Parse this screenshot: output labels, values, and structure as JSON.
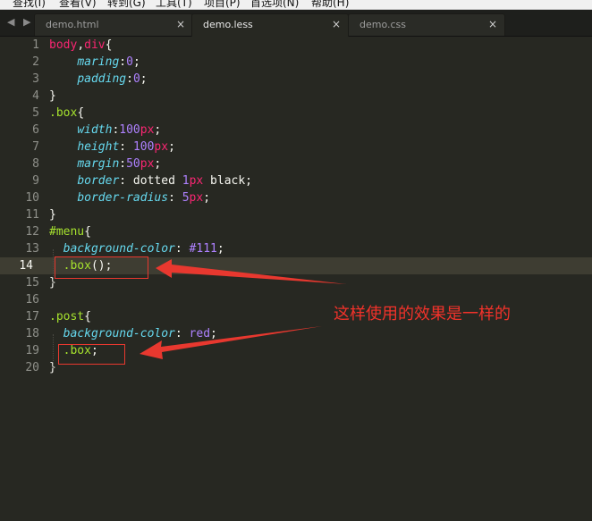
{
  "menu": [
    "查找(I)",
    "查看(V)",
    "转到(G)",
    "工具(T)",
    "项目(P)",
    "首选项(N)",
    "帮助(H)"
  ],
  "nav_arrows": "◀ ▶",
  "tabs": [
    {
      "label": "demo.html",
      "close": "×",
      "active": false
    },
    {
      "label": "demo.less",
      "close": "×",
      "active": true
    },
    {
      "label": "demo.css",
      "close": "×",
      "active": false
    }
  ],
  "current_line": 14,
  "code": [
    {
      "n": "1",
      "tokens": [
        [
          "tag",
          "body"
        ],
        [
          "",
          ","
        ],
        [
          "tag",
          "div"
        ],
        [
          "",
          "{"
        ]
      ]
    },
    {
      "n": "2",
      "tokens": [
        [
          "",
          "    "
        ],
        [
          "prop",
          "maring"
        ],
        [
          "",
          ":"
        ],
        [
          "num",
          "0"
        ],
        [
          "",
          ";"
        ]
      ]
    },
    {
      "n": "3",
      "tokens": [
        [
          "",
          "    "
        ],
        [
          "prop",
          "padding"
        ],
        [
          "",
          ":"
        ],
        [
          "num",
          "0"
        ],
        [
          "",
          ";"
        ]
      ]
    },
    {
      "n": "4",
      "tokens": [
        [
          "",
          "}"
        ]
      ]
    },
    {
      "n": "5",
      "tokens": [
        [
          "cls",
          ".box"
        ],
        [
          "",
          "{"
        ]
      ]
    },
    {
      "n": "6",
      "tokens": [
        [
          "",
          "    "
        ],
        [
          "prop",
          "width"
        ],
        [
          "",
          ":"
        ],
        [
          "num",
          "100"
        ],
        [
          "tag",
          "px"
        ],
        [
          "",
          ";"
        ]
      ]
    },
    {
      "n": "7",
      "tokens": [
        [
          "",
          "    "
        ],
        [
          "prop",
          "height"
        ],
        [
          "",
          ": "
        ],
        [
          "num",
          "100"
        ],
        [
          "tag",
          "px"
        ],
        [
          "",
          ";"
        ]
      ]
    },
    {
      "n": "8",
      "tokens": [
        [
          "",
          "    "
        ],
        [
          "prop",
          "margin"
        ],
        [
          "",
          ":"
        ],
        [
          "num",
          "50"
        ],
        [
          "tag",
          "px"
        ],
        [
          "",
          ";"
        ]
      ]
    },
    {
      "n": "9",
      "tokens": [
        [
          "",
          "    "
        ],
        [
          "prop",
          "border"
        ],
        [
          "",
          ": dotted "
        ],
        [
          "num",
          "1"
        ],
        [
          "tag",
          "px"
        ],
        [
          "",
          " black;"
        ]
      ]
    },
    {
      "n": "10",
      "tokens": [
        [
          "",
          "    "
        ],
        [
          "prop",
          "border-radius"
        ],
        [
          "",
          ": "
        ],
        [
          "num",
          "5"
        ],
        [
          "tag",
          "px"
        ],
        [
          "",
          ";"
        ]
      ]
    },
    {
      "n": "11",
      "tokens": [
        [
          "",
          "}"
        ]
      ]
    },
    {
      "n": "12",
      "tokens": [
        [
          "cls",
          "#menu"
        ],
        [
          "",
          "{"
        ]
      ]
    },
    {
      "n": "13",
      "tokens": [
        [
          "",
          "  "
        ],
        [
          "prop",
          "background-color"
        ],
        [
          "",
          ": "
        ],
        [
          "num",
          "#111"
        ],
        [
          "",
          ";"
        ]
      ]
    },
    {
      "n": "14",
      "tokens": [
        [
          "",
          "  "
        ],
        [
          "cls",
          ".box"
        ],
        [
          "",
          "();"
        ]
      ]
    },
    {
      "n": "15",
      "tokens": [
        [
          "",
          "}"
        ]
      ]
    },
    {
      "n": "16",
      "tokens": []
    },
    {
      "n": "17",
      "tokens": [
        [
          "cls",
          ".post"
        ],
        [
          "",
          "{"
        ]
      ]
    },
    {
      "n": "18",
      "tokens": [
        [
          "",
          "  "
        ],
        [
          "prop",
          "background-color"
        ],
        [
          "",
          ": "
        ],
        [
          "num",
          "red"
        ],
        [
          "",
          ";"
        ]
      ]
    },
    {
      "n": "19",
      "tokens": [
        [
          "",
          "  "
        ],
        [
          "cls",
          ".box"
        ],
        [
          "",
          ";"
        ]
      ]
    },
    {
      "n": "20",
      "tokens": [
        [
          "",
          "}"
        ]
      ]
    }
  ],
  "annotation": "这样使用的效果是一样的",
  "colors": {
    "background": "#272822",
    "annotation_red": "#e8382f",
    "keyword": "#f92672",
    "property": "#66d9ef",
    "number": "#ae81ff",
    "selector": "#a6e22e"
  }
}
